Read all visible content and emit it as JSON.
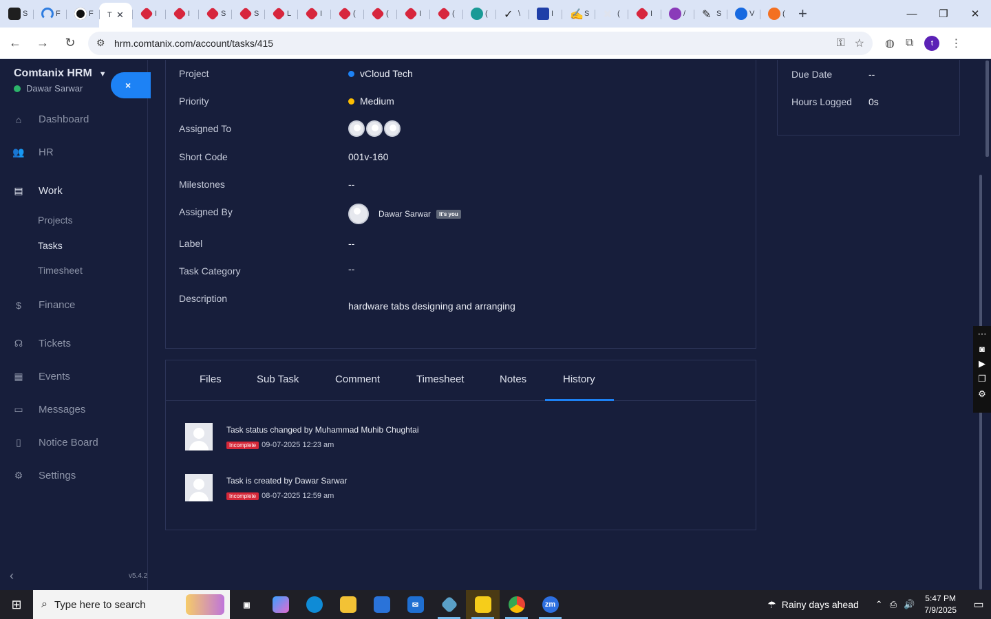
{
  "browser": {
    "tabs": [
      {
        "icon": "dropbox-icon",
        "title": "S"
      },
      {
        "icon": "wifi-icon",
        "title": "F"
      },
      {
        "icon": "target-icon",
        "title": "F"
      },
      {
        "icon": "app-icon",
        "title": "T",
        "active": true
      },
      {
        "icon": "diamond-icon",
        "title": "I"
      },
      {
        "icon": "diamond-icon",
        "title": "I"
      },
      {
        "icon": "diamond-icon",
        "title": "S"
      },
      {
        "icon": "diamond-icon",
        "title": "S"
      },
      {
        "icon": "diamond-icon",
        "title": "L"
      },
      {
        "icon": "diamond-icon",
        "title": "I"
      },
      {
        "icon": "diamond-icon",
        "title": "("
      },
      {
        "icon": "diamond-icon",
        "title": "("
      },
      {
        "icon": "diamond-icon",
        "title": "I"
      },
      {
        "icon": "diamond-icon",
        "title": "("
      },
      {
        "icon": "teal-icon",
        "title": "("
      },
      {
        "icon": "check-icon",
        "title": "\\"
      },
      {
        "icon": "scale-icon",
        "title": "I"
      },
      {
        "icon": "sign-icon",
        "title": "S"
      },
      {
        "icon": "x-icon",
        "title": "("
      },
      {
        "icon": "diamond-icon",
        "title": "I"
      },
      {
        "icon": "purple-icon",
        "title": "/"
      },
      {
        "icon": "feather-icon",
        "title": "S"
      },
      {
        "icon": "wave-icon",
        "title": "V"
      },
      {
        "icon": "swoosh-icon",
        "title": "("
      }
    ],
    "url": "hrm.comtanix.com/account/tasks/415",
    "profile_initial": "t"
  },
  "sidebar": {
    "brand": "Comtanix HRM",
    "user": "Dawar Sarwar",
    "close_label": "×",
    "items": [
      {
        "label": "Dashboard",
        "icon": "home-icon"
      },
      {
        "label": "HR",
        "icon": "users-icon"
      },
      {
        "label": "Work",
        "icon": "briefcase-icon"
      },
      {
        "label": "Finance",
        "icon": "dollar-icon"
      },
      {
        "label": "Tickets",
        "icon": "headset-icon"
      },
      {
        "label": "Events",
        "icon": "calendar-icon"
      },
      {
        "label": "Messages",
        "icon": "message-icon"
      },
      {
        "label": "Notice Board",
        "icon": "clipboard-icon"
      },
      {
        "label": "Settings",
        "icon": "gear-icon"
      }
    ],
    "work_subitems": [
      "Projects",
      "Tasks",
      "Timesheet"
    ],
    "version": "v5.4.2"
  },
  "task": {
    "project_label": "Project",
    "project": "vCloud Tech",
    "project_color": "#1d82f5",
    "priority_label": "Priority",
    "priority": "Medium",
    "priority_color": "#fcbd01",
    "assigned_to_label": "Assigned To",
    "short_code_label": "Short Code",
    "short_code": "001v-160",
    "milestones_label": "Milestones",
    "milestones": "--",
    "assigned_by_label": "Assigned By",
    "assigned_by": "Dawar Sarwar",
    "its_you": "It's you",
    "label_label": "Label",
    "label": "--",
    "category_label": "Task Category",
    "category": "--",
    "description_label": "Description",
    "description": "hardware tabs designing and arranging"
  },
  "info": {
    "due_date_label": "Due Date",
    "due_date": "--",
    "hours_logged_label": "Hours Logged",
    "hours_logged": "0s"
  },
  "tabs": [
    "Files",
    "Sub Task",
    "Comment",
    "Timesheet",
    "Notes",
    "History"
  ],
  "active_tab": "History",
  "history": [
    {
      "text": "Task status changed by Muhammad Muhib Chughtai",
      "status": "Incomplete",
      "time": "09-07-2025 12:23 am"
    },
    {
      "text": "Task is created by Dawar Sarwar",
      "status": "Incomplete",
      "time": "08-07-2025 12:59 am"
    }
  ],
  "taskbar": {
    "search_placeholder": "Type here to search",
    "weather": "Rainy days ahead",
    "time": "5:47 PM",
    "date": "7/9/2025"
  }
}
